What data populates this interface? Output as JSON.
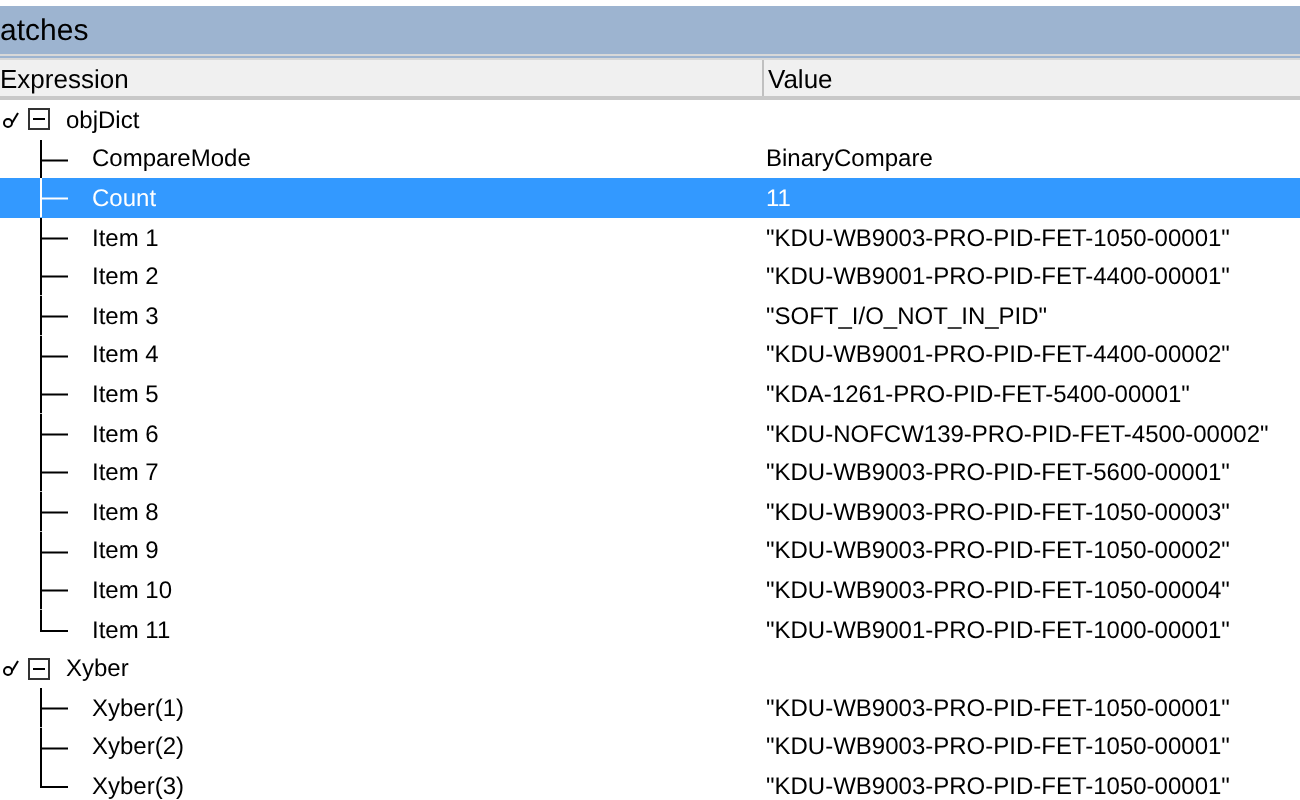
{
  "panel": {
    "title": "atches"
  },
  "columns": [
    "Expression",
    "Value"
  ],
  "watches": [
    {
      "label": "objDict",
      "expanded": true,
      "selected": false,
      "children": [
        {
          "label": "CompareMode",
          "value": "BinaryCompare",
          "selected": false
        },
        {
          "label": "Count",
          "value": "11",
          "selected": true
        },
        {
          "label": "Item 1",
          "value": "\"KDU-WB9003-PRO-PID-FET-1050-00001\"",
          "selected": false
        },
        {
          "label": "Item 2",
          "value": "\"KDU-WB9001-PRO-PID-FET-4400-00001\"",
          "selected": false
        },
        {
          "label": "Item 3",
          "value": "\"SOFT_I/O_NOT_IN_PID\"",
          "selected": false
        },
        {
          "label": "Item 4",
          "value": "\"KDU-WB9001-PRO-PID-FET-4400-00002\"",
          "selected": false
        },
        {
          "label": "Item 5",
          "value": "\"KDA-1261-PRO-PID-FET-5400-00001\"",
          "selected": false
        },
        {
          "label": "Item 6",
          "value": "\"KDU-NOFCW139-PRO-PID-FET-4500-00002\"",
          "selected": false
        },
        {
          "label": "Item 7",
          "value": "\"KDU-WB9003-PRO-PID-FET-5600-00001\"",
          "selected": false
        },
        {
          "label": "Item 8",
          "value": "\"KDU-WB9003-PRO-PID-FET-1050-00003\"",
          "selected": false
        },
        {
          "label": "Item 9",
          "value": "\"KDU-WB9003-PRO-PID-FET-1050-00002\"",
          "selected": false
        },
        {
          "label": "Item 10",
          "value": "\"KDU-WB9003-PRO-PID-FET-1050-00004\"",
          "selected": false
        },
        {
          "label": "Item 11",
          "value": "\"KDU-WB9001-PRO-PID-FET-1000-00001\"",
          "selected": false
        }
      ]
    },
    {
      "label": "Xyber",
      "expanded": true,
      "selected": false,
      "children": [
        {
          "label": "Xyber(1)",
          "value": "\"KDU-WB9003-PRO-PID-FET-1050-00001\"",
          "selected": false
        },
        {
          "label": "Xyber(2)",
          "value": "\"KDU-WB9003-PRO-PID-FET-1050-00001\"",
          "selected": false
        },
        {
          "label": "Xyber(3)",
          "value": "\"KDU-WB9003-PRO-PID-FET-1050-00001\"",
          "selected": false
        }
      ]
    }
  ]
}
